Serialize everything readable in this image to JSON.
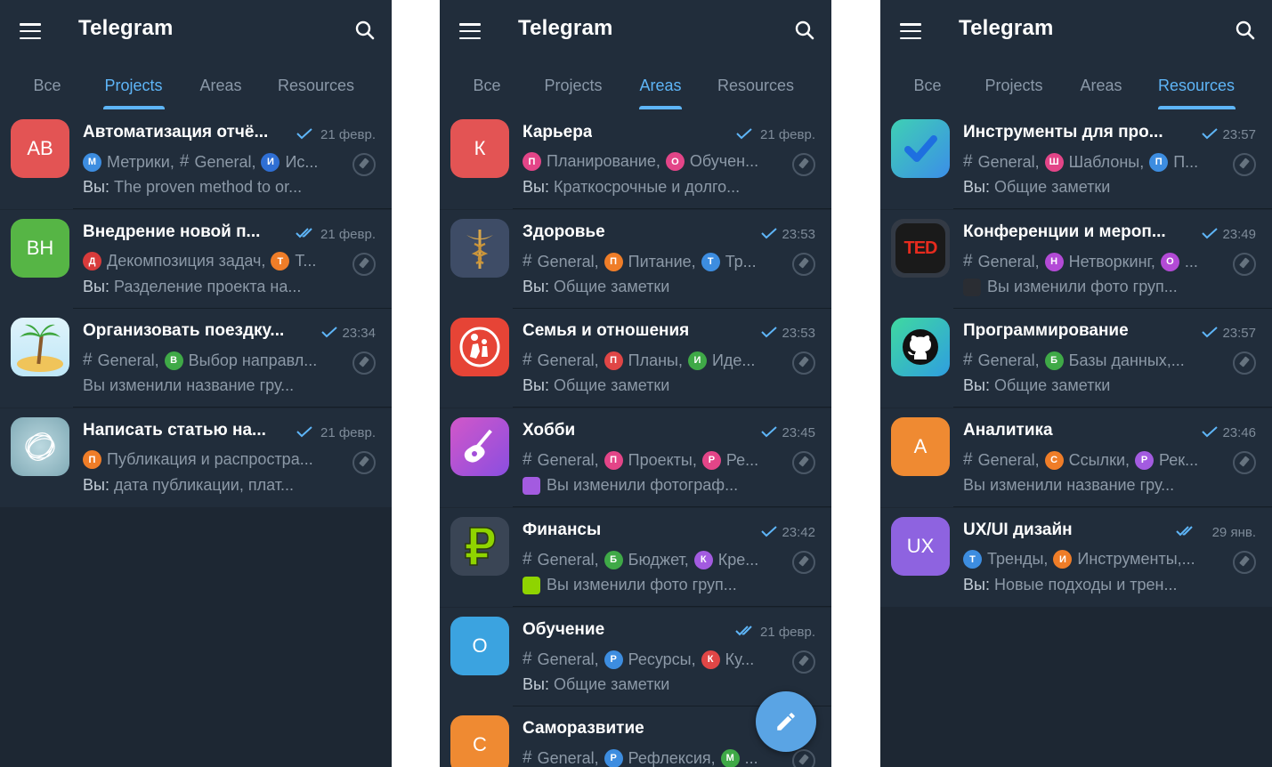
{
  "screens": [
    {
      "title": "Telegram",
      "tabs": [
        "Все",
        "Projects",
        "Areas",
        "Resources"
      ],
      "active_tab": 1,
      "chats": [
        {
          "avatar_text": "AB",
          "avatar_color": "#e35454",
          "title": "Автоматизация отчё...",
          "check": "single",
          "time": "21 февр.",
          "topics": [
            {
              "badge": "М",
              "color": "#3d8de0",
              "text": "Метрики,"
            },
            {
              "hash": true,
              "text": "General,"
            },
            {
              "badge": "И",
              "color": "#2f6fd4",
              "text": "Ис..."
            }
          ],
          "you": "Вы:",
          "message": "The proven method to or..."
        },
        {
          "avatar_text": "ВН",
          "avatar_color": "#56b545",
          "title": "Внедрение новой п...",
          "check": "double",
          "time": "21 февр.",
          "topics": [
            {
              "badge": "Д",
              "color": "#d83b3b",
              "text": "Декомпозиция задач,"
            },
            {
              "badge": "Т",
              "color": "#ef7d28",
              "text": "Т..."
            }
          ],
          "you": "Вы:",
          "message": "Разделение проекта на..."
        },
        {
          "avatar_icon": "palm-island-icon",
          "title": "Организовать поездку...",
          "check": "single",
          "time": "23:34",
          "topics": [
            {
              "hash": true,
              "text": "General,"
            },
            {
              "badge": "В",
              "color": "#3fa947",
              "text": "Выбор направл..."
            }
          ],
          "you": "",
          "message": "Вы изменили название гру..."
        },
        {
          "avatar_icon": "scribble-icon",
          "title": "Написать статью на...",
          "check": "single",
          "time": "21 февр.",
          "topics": [
            {
              "badge": "П",
              "color": "#ef7d28",
              "text": "Публикация и распростра..."
            }
          ],
          "you": "Вы:",
          "message": "дата публикации, плат..."
        }
      ]
    },
    {
      "title": "Telegram",
      "tabs": [
        "Все",
        "Projects",
        "Areas",
        "Resources"
      ],
      "active_tab": 2,
      "chats": [
        {
          "avatar_text": "К",
          "avatar_color": "#e35454",
          "title": "Карьера",
          "check": "single",
          "time": "21 февр.",
          "topics": [
            {
              "badge": "П",
              "color": "#e34588",
              "text": "Планирование,"
            },
            {
              "badge": "О",
              "color": "#e34588",
              "text": "Обучен..."
            }
          ],
          "you": "Вы:",
          "message": "Краткосрочные и долго..."
        },
        {
          "avatar_icon": "caduceus-icon",
          "title": "Здоровье",
          "check": "single",
          "time": "23:53",
          "topics": [
            {
              "hash": true,
              "text": "General,"
            },
            {
              "badge": "П",
              "color": "#ef7d28",
              "text": "Питание,"
            },
            {
              "badge": "Т",
              "color": "#3d8de0",
              "text": "Тр..."
            }
          ],
          "you": "Вы:",
          "message": "Общие заметки"
        },
        {
          "avatar_icon": "family-icon",
          "title": "Семья и отношения",
          "check": "single",
          "time": "23:53",
          "topics": [
            {
              "hash": true,
              "text": "General,"
            },
            {
              "badge": "П",
              "color": "#e04646",
              "text": "Планы,"
            },
            {
              "badge": "И",
              "color": "#3fa947",
              "text": "Иде..."
            }
          ],
          "you": "Вы:",
          "message": "Общие заметки"
        },
        {
          "avatar_icon": "guitar-icon",
          "title": "Хобби",
          "check": "single",
          "time": "23:45",
          "topics": [
            {
              "hash": true,
              "text": "General,"
            },
            {
              "badge": "П",
              "color": "#e34588",
              "text": "Проекты,"
            },
            {
              "badge": "Р",
              "color": "#e34588",
              "text": "Ре..."
            }
          ],
          "you": "",
          "message": "Вы изменили фотограф...",
          "thumb_color": "#a35be0"
        },
        {
          "avatar_icon": "ruble-icon",
          "title": "Финансы",
          "check": "single",
          "time": "23:42",
          "topics": [
            {
              "hash": true,
              "text": "General,"
            },
            {
              "badge": "Б",
              "color": "#3fa947",
              "text": "Бюджет,"
            },
            {
              "badge": "К",
              "color": "#a35be0",
              "text": "Кре..."
            }
          ],
          "you": "",
          "message": "Вы изменили фото груп...",
          "thumb_color": "#8fd400"
        },
        {
          "avatar_text": "О",
          "avatar_color": "#3ba3e0",
          "title": "Обучение",
          "check": "double",
          "time": "21 февр.",
          "topics": [
            {
              "hash": true,
              "text": "General,"
            },
            {
              "badge": "Р",
              "color": "#3d8de0",
              "text": "Ресурсы,"
            },
            {
              "badge": "К",
              "color": "#e04646",
              "text": "Ку..."
            }
          ],
          "you": "Вы:",
          "message": "Общие заметки"
        },
        {
          "avatar_text": "С",
          "avatar_color": "#ef8a32",
          "title": "Саморазвитие",
          "check": "double",
          "time": "",
          "topics": [
            {
              "hash": true,
              "text": "General,"
            },
            {
              "badge": "Р",
              "color": "#3d8de0",
              "text": "Рефлексия,"
            },
            {
              "badge": "М",
              "color": "#3fa947",
              "text": "..."
            }
          ],
          "you": "",
          "message": ""
        }
      ]
    },
    {
      "title": "Telegram",
      "tabs": [
        "Все",
        "Projects",
        "Areas",
        "Resources"
      ],
      "active_tab": 3,
      "chats": [
        {
          "avatar_icon": "checkmark-icon",
          "title": "Инструменты для про...",
          "check": "single",
          "time": "23:57",
          "topics": [
            {
              "hash": true,
              "text": "General,"
            },
            {
              "badge": "Ш",
              "color": "#e34588",
              "text": "Шаблоны,"
            },
            {
              "badge": "П",
              "color": "#3d8de0",
              "text": "П..."
            }
          ],
          "you": "Вы:",
          "message": "Общие заметки"
        },
        {
          "avatar_icon": "ted-logo-icon",
          "title": "Конференции и мероп...",
          "check": "single",
          "time": "23:49",
          "topics": [
            {
              "hash": true,
              "text": "General,"
            },
            {
              "badge": "Н",
              "color": "#b34ad6",
              "text": "Нетворкинг,"
            },
            {
              "badge": "О",
              "color": "#b34ad6",
              "text": "..."
            }
          ],
          "you": "",
          "message": "Вы изменили фото груп...",
          "thumb_color": "#2a2d33"
        },
        {
          "avatar_icon": "github-icon",
          "title": "Программирование",
          "check": "single",
          "time": "23:57",
          "topics": [
            {
              "hash": true,
              "text": "General,"
            },
            {
              "badge": "Б",
              "color": "#3fa947",
              "text": "Базы данных,..."
            }
          ],
          "you": "Вы:",
          "message": "Общие заметки"
        },
        {
          "avatar_text": "А",
          "avatar_color": "#ef8a32",
          "title": "Аналитика",
          "check": "single",
          "time": "23:46",
          "topics": [
            {
              "hash": true,
              "text": "General,"
            },
            {
              "badge": "С",
              "color": "#ef7d28",
              "text": "Ссылки,"
            },
            {
              "badge": "Р",
              "color": "#a35be0",
              "text": "Рек..."
            }
          ],
          "you": "",
          "message": "Вы изменили название гру..."
        },
        {
          "avatar_text": "UX",
          "avatar_color": "#8e63e0",
          "title": "UX/UI дизайн",
          "check": "double",
          "time": "29 янв.",
          "topics": [
            {
              "badge": "Т",
              "color": "#3d8de0",
              "text": "Тренды,"
            },
            {
              "badge": "И",
              "color": "#ef7d28",
              "text": "Инструменты,..."
            }
          ],
          "you": "Вы:",
          "message": "Новые подходы и трен..."
        }
      ]
    }
  ]
}
